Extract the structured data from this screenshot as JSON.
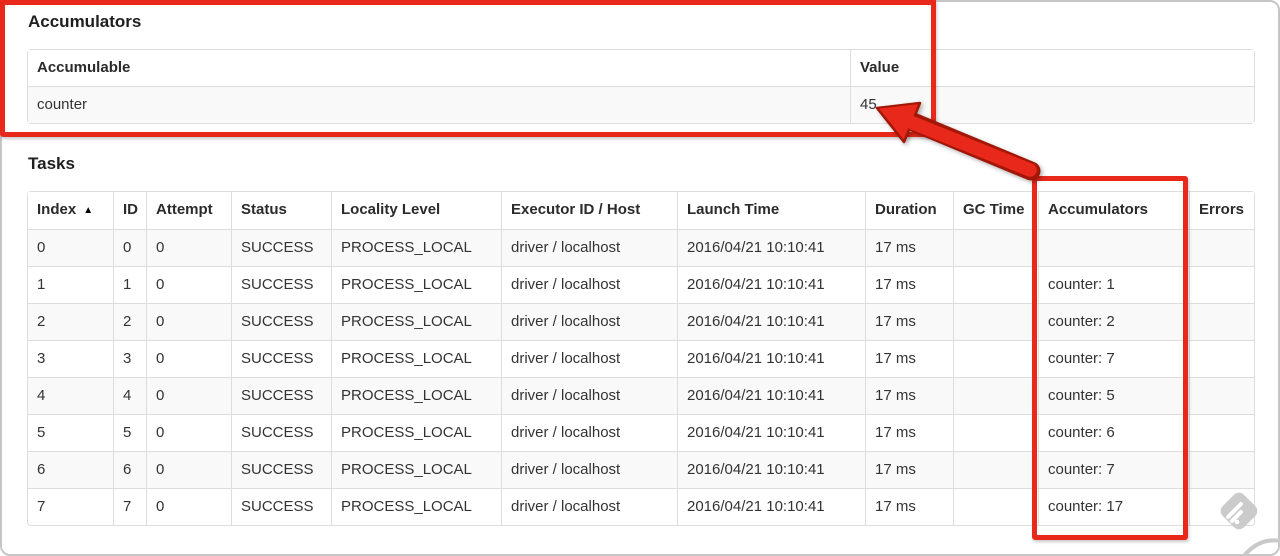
{
  "colors": {
    "annotation_red": "#e8281b",
    "annotation_red_outline": "#a21708",
    "table_border": "#dddddd",
    "row_stripe": "#f9f9f9",
    "watermark_gray": "#cbcbcb"
  },
  "accumulators_section": {
    "title": "Accumulators",
    "table": {
      "columns": [
        {
          "label": "Accumulable"
        },
        {
          "label": "Value"
        }
      ],
      "rows": [
        [
          "counter",
          "45"
        ]
      ]
    }
  },
  "tasks_section": {
    "title": "Tasks",
    "table": {
      "columns": [
        {
          "label": "Index",
          "sort_icon": "▲"
        },
        {
          "label": "ID"
        },
        {
          "label": "Attempt"
        },
        {
          "label": "Status"
        },
        {
          "label": "Locality Level"
        },
        {
          "label": "Executor ID / Host"
        },
        {
          "label": "Launch Time"
        },
        {
          "label": "Duration"
        },
        {
          "label": "GC Time"
        },
        {
          "label": "Accumulators"
        },
        {
          "label": "Errors"
        }
      ],
      "rows": [
        [
          "0",
          "0",
          "0",
          "SUCCESS",
          "PROCESS_LOCAL",
          "driver / localhost",
          "2016/04/21 10:10:41",
          "17 ms",
          "",
          "",
          ""
        ],
        [
          "1",
          "1",
          "0",
          "SUCCESS",
          "PROCESS_LOCAL",
          "driver / localhost",
          "2016/04/21 10:10:41",
          "17 ms",
          "",
          "counter: 1",
          ""
        ],
        [
          "2",
          "2",
          "0",
          "SUCCESS",
          "PROCESS_LOCAL",
          "driver / localhost",
          "2016/04/21 10:10:41",
          "17 ms",
          "",
          "counter: 2",
          ""
        ],
        [
          "3",
          "3",
          "0",
          "SUCCESS",
          "PROCESS_LOCAL",
          "driver / localhost",
          "2016/04/21 10:10:41",
          "17 ms",
          "",
          "counter: 7",
          ""
        ],
        [
          "4",
          "4",
          "0",
          "SUCCESS",
          "PROCESS_LOCAL",
          "driver / localhost",
          "2016/04/21 10:10:41",
          "17 ms",
          "",
          "counter: 5",
          ""
        ],
        [
          "5",
          "5",
          "0",
          "SUCCESS",
          "PROCESS_LOCAL",
          "driver / localhost",
          "2016/04/21 10:10:41",
          "17 ms",
          "",
          "counter: 6",
          ""
        ],
        [
          "6",
          "6",
          "0",
          "SUCCESS",
          "PROCESS_LOCAL",
          "driver / localhost",
          "2016/04/21 10:10:41",
          "17 ms",
          "",
          "counter: 7",
          ""
        ],
        [
          "7",
          "7",
          "0",
          "SUCCESS",
          "PROCESS_LOCAL",
          "driver / localhost",
          "2016/04/21 10:10:41",
          "17 ms",
          "",
          "counter: 17",
          ""
        ]
      ]
    }
  },
  "annotations": {
    "highlight_color": "#e8281b",
    "shapes": [
      "box-around-accumulators-summary",
      "arrow-pointing-to-value-45",
      "box-around-tasks-accumulators-column"
    ]
  }
}
